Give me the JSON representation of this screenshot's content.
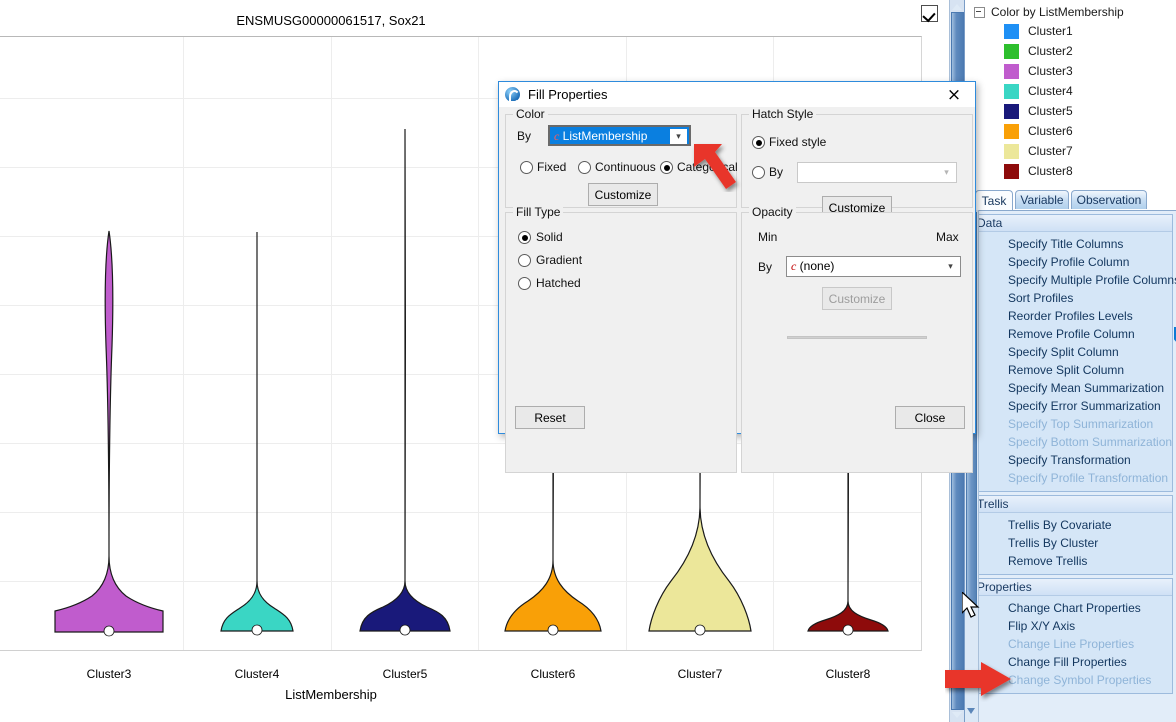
{
  "chart": {
    "title": "ENSMUSG00000061517, Sox21",
    "xaxis_title": "ListMembership",
    "header_checkbox_checked": true
  },
  "chart_data": {
    "type": "violin",
    "title": "ENSMUSG00000061517, Sox21",
    "xlabel": "ListMembership",
    "ylabel": "",
    "grid": true,
    "legend_position": "right-panel",
    "categories": [
      "Cluster3",
      "Cluster4",
      "Cluster5",
      "Cluster6",
      "Cluster7",
      "Cluster8"
    ],
    "colors": [
      "#c05ccd",
      "#3ad6c4",
      "#19197a",
      "#f9a007",
      "#ece79a",
      "#8e0b0b"
    ],
    "series": [
      {
        "name": "Cluster3",
        "color": "#c05ccd",
        "median": 0.0,
        "max_extent_frac": 0.68,
        "body_width_frac": 0.95,
        "body_height_frac": 0.13,
        "upper_tail_bulge": true
      },
      {
        "name": "Cluster4",
        "color": "#3ad6c4",
        "median": 0.0,
        "max_extent_frac": 0.68,
        "body_width_frac": 0.62,
        "body_height_frac": 0.085,
        "upper_tail_bulge": false
      },
      {
        "name": "Cluster5",
        "color": "#19197a",
        "median": 0.0,
        "max_extent_frac": 0.86,
        "body_width_frac": 0.8,
        "body_height_frac": 0.085,
        "upper_tail_bulge": false
      },
      {
        "name": "Cluster6",
        "color": "#f9a007",
        "median": 0.0,
        "max_extent_frac": 0.54,
        "body_width_frac": 0.9,
        "body_height_frac": 0.125,
        "upper_tail_bulge": false
      },
      {
        "name": "Cluster7",
        "color": "#ece79a",
        "median": 0.0,
        "max_extent_frac": 0.54,
        "body_width_frac": 0.95,
        "body_height_frac": 0.26,
        "upper_tail_bulge": false
      },
      {
        "name": "Cluster8",
        "color": "#8e0b0b",
        "median": 0.0,
        "max_extent_frac": 0.54,
        "body_width_frac": 0.8,
        "body_height_frac": 0.055,
        "upper_tail_bulge": false
      }
    ]
  },
  "legend": {
    "title": "Color by ListMembership",
    "items": [
      {
        "label": "Cluster1",
        "color": "#1e90f5"
      },
      {
        "label": "Cluster2",
        "color": "#2dbf2d"
      },
      {
        "label": "Cluster3",
        "color": "#c05ccd"
      },
      {
        "label": "Cluster4",
        "color": "#3ad6c4"
      },
      {
        "label": "Cluster5",
        "color": "#19197a"
      },
      {
        "label": "Cluster6",
        "color": "#f9a007"
      },
      {
        "label": "Cluster7",
        "color": "#ece79a"
      },
      {
        "label": "Cluster8",
        "color": "#8e0b0b"
      }
    ]
  },
  "tabs": [
    {
      "label": "Task",
      "active": true
    },
    {
      "label": "Variable",
      "active": false
    },
    {
      "label": "Observation",
      "active": false
    }
  ],
  "task_panel": {
    "sections": [
      {
        "header": "Data",
        "items": [
          {
            "label": "Specify Title Columns",
            "disabled": false
          },
          {
            "label": "Specify Profile Column",
            "disabled": false
          },
          {
            "label": "Specify Multiple Profile Columns",
            "disabled": false
          },
          {
            "label": "Sort Profiles",
            "disabled": false
          },
          {
            "label": "Reorder Profiles Levels",
            "disabled": false
          },
          {
            "label": "Remove Profile Column",
            "disabled": false
          },
          {
            "label": "Specify Split Column",
            "disabled": false
          },
          {
            "label": "Remove Split Column",
            "disabled": false
          },
          {
            "label": "Specify Mean Summarization",
            "disabled": false
          },
          {
            "label": "Specify Error Summarization",
            "disabled": false
          },
          {
            "label": "Specify Top Summarization",
            "disabled": true
          },
          {
            "label": "Specify Bottom Summarization",
            "disabled": true
          },
          {
            "label": "Specify Transformation",
            "disabled": false
          },
          {
            "label": "Specify Profile Transformation",
            "disabled": true
          }
        ]
      },
      {
        "header": "Trellis",
        "items": [
          {
            "label": "Trellis By Covariate",
            "disabled": false
          },
          {
            "label": "Trellis By Cluster",
            "disabled": false
          },
          {
            "label": "Remove Trellis",
            "disabled": false
          }
        ]
      },
      {
        "header": "Properties",
        "items": [
          {
            "label": "Change Chart Properties",
            "disabled": false
          },
          {
            "label": "Flip X/Y Axis",
            "disabled": false
          },
          {
            "label": "Change Line Properties",
            "disabled": true
          },
          {
            "label": "Change Fill Properties",
            "disabled": false
          },
          {
            "label": "Change Symbol Properties",
            "disabled": true
          }
        ]
      }
    ]
  },
  "dialog": {
    "title": "Fill Properties",
    "close_label": "×",
    "color": {
      "legend": "Color",
      "by_label": "By",
      "combo_prefix": "c",
      "combo_value": "ListMembership",
      "radios": [
        {
          "label": "Fixed",
          "checked": false
        },
        {
          "label": "Continuous",
          "checked": false
        },
        {
          "label": "Categorical",
          "checked": true
        }
      ],
      "customize_label": "Customize"
    },
    "hatch": {
      "legend": "Hatch Style",
      "radios": [
        {
          "label": "Fixed style",
          "checked": true
        },
        {
          "label": "By",
          "checked": false
        }
      ],
      "combo_value": "",
      "customize_label": "Customize"
    },
    "fill_type": {
      "legend": "Fill Type",
      "radios": [
        {
          "label": "Solid",
          "checked": true
        },
        {
          "label": "Gradient",
          "checked": false
        },
        {
          "label": "Hatched",
          "checked": false
        }
      ]
    },
    "opacity": {
      "legend": "Opacity",
      "min_label": "Min",
      "max_label": "Max",
      "by_label": "By",
      "combo_prefix": "c",
      "combo_value": "(none)",
      "customize_label": "Customize",
      "slider_value_pct": 100
    },
    "reset_label": "Reset",
    "close_button_label": "Close"
  },
  "annotations": {
    "arrow_color": "#e8342a",
    "arrow_combo": "arrow-pointing-to-color-by-combo",
    "arrow_menu": "arrow-pointing-to-change-fill-properties"
  }
}
